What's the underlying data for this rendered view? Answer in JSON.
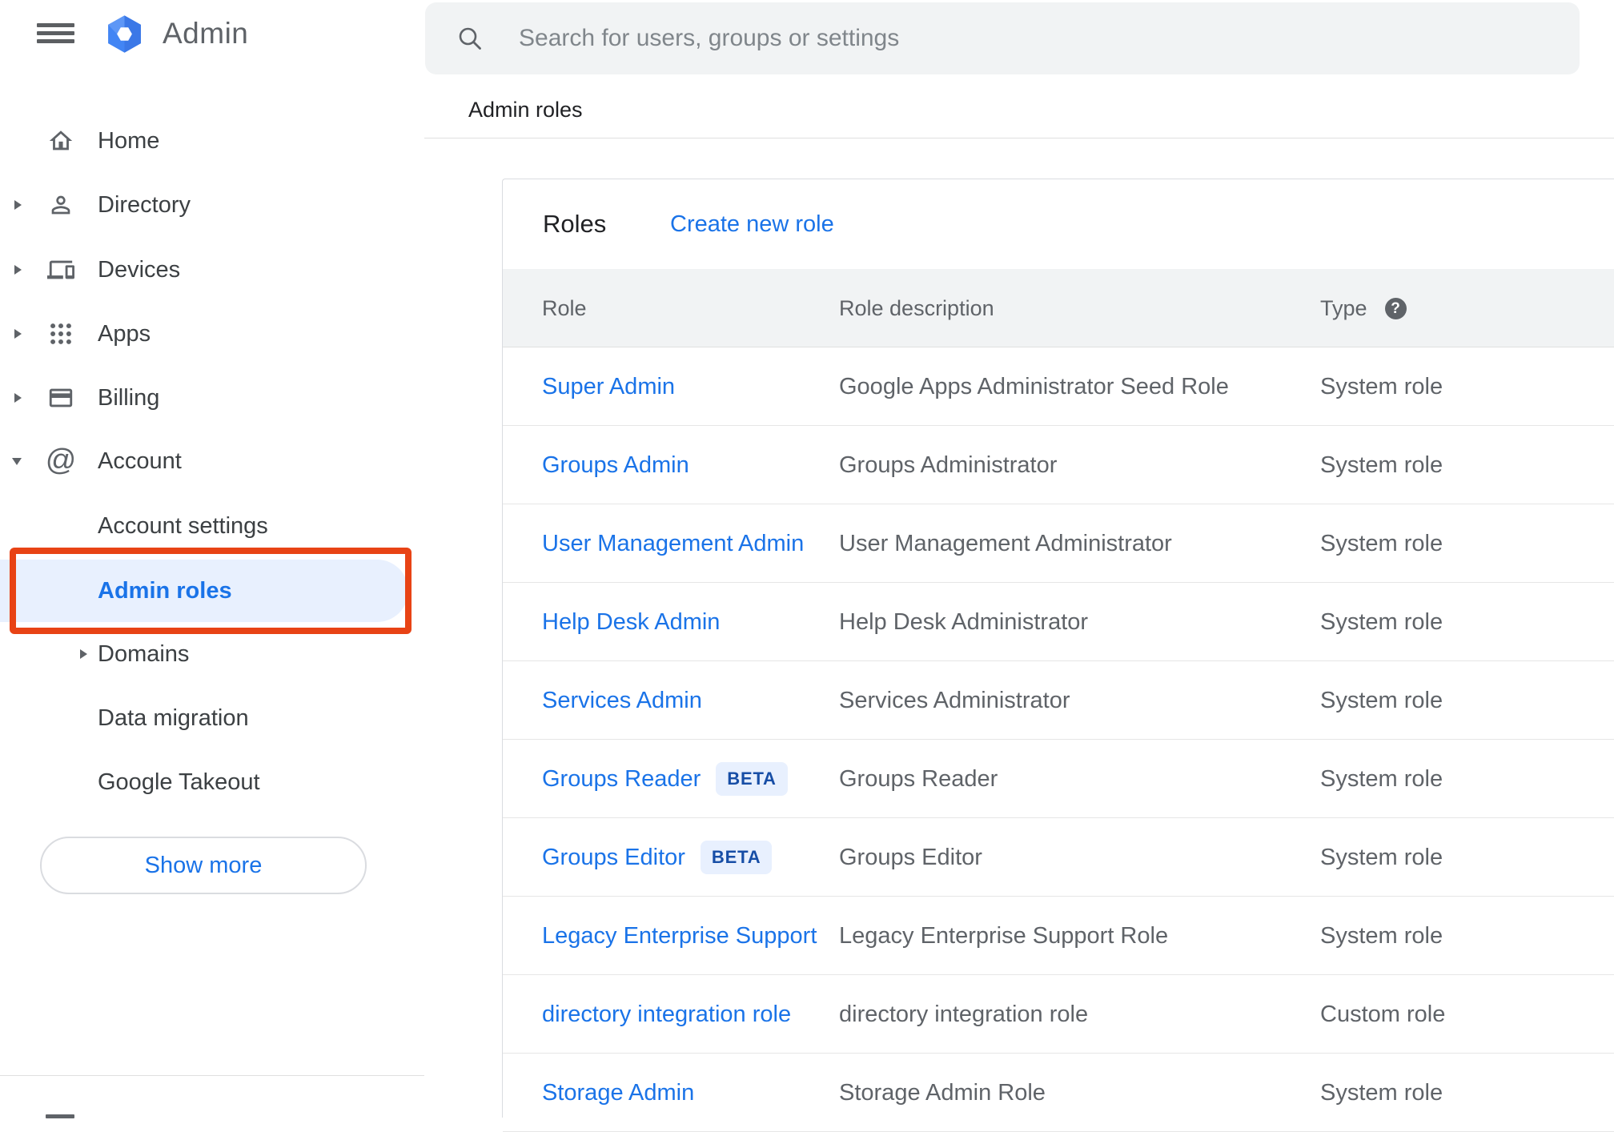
{
  "app": {
    "title": "Admin"
  },
  "search": {
    "placeholder": "Search for users, groups or settings"
  },
  "breadcrumb": {
    "label": "Admin roles"
  },
  "sidebar": {
    "items": [
      {
        "label": "Home"
      },
      {
        "label": "Directory"
      },
      {
        "label": "Devices"
      },
      {
        "label": "Apps"
      },
      {
        "label": "Billing"
      },
      {
        "label": "Account"
      }
    ],
    "account_children": [
      {
        "label": "Account settings"
      },
      {
        "label": "Admin roles",
        "active": true
      },
      {
        "label": "Domains"
      },
      {
        "label": "Data migration"
      },
      {
        "label": "Google Takeout"
      }
    ],
    "show_more_label": "Show more"
  },
  "panel": {
    "title": "Roles",
    "create_link_label": "Create new role"
  },
  "table": {
    "columns": {
      "role": "Role",
      "description": "Role description",
      "type": "Type"
    },
    "rows": [
      {
        "role": "Super Admin",
        "description": "Google Apps Administrator Seed Role",
        "type": "System role"
      },
      {
        "role": "Groups Admin",
        "description": "Groups Administrator",
        "type": "System role"
      },
      {
        "role": "User Management Admin",
        "description": "User Management Administrator",
        "type": "System role"
      },
      {
        "role": "Help Desk Admin",
        "description": "Help Desk Administrator",
        "type": "System role"
      },
      {
        "role": "Services Admin",
        "description": "Services Administrator",
        "type": "System role"
      },
      {
        "role": "Groups Reader",
        "badge": "BETA",
        "description": "Groups Reader",
        "type": "System role"
      },
      {
        "role": "Groups Editor",
        "badge": "BETA",
        "description": "Groups Editor",
        "type": "System role"
      },
      {
        "role": "Legacy Enterprise Support",
        "description": "Legacy Enterprise Support Role",
        "type": "System role"
      },
      {
        "role": "directory integration role",
        "description": "directory integration role",
        "type": "Custom role"
      },
      {
        "role": "Storage Admin",
        "description": "Storage Admin Role",
        "type": "System role"
      }
    ]
  },
  "icons": {
    "help_glyph": "?",
    "at_glyph": "@"
  },
  "colors": {
    "accent_blue": "#1a73e8",
    "pill_bg": "#e8f0fe",
    "annotation_red": "#e84315",
    "badge_text": "#174ea6",
    "gray_text": "#5f6368",
    "dark_text": "#202124",
    "band_bg": "#f1f3f4"
  }
}
